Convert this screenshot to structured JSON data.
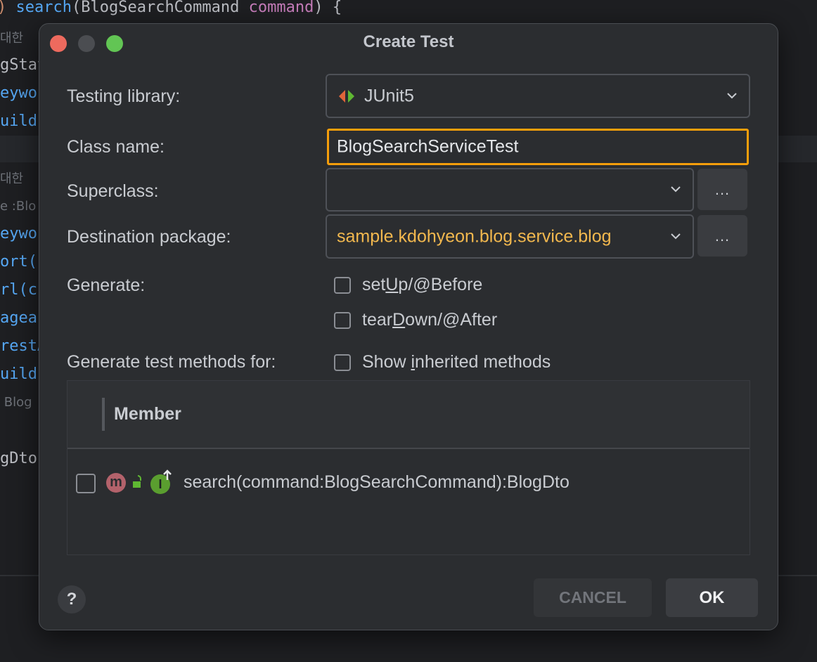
{
  "editor": {
    "line1": {
      "method": "search",
      "type": "BlogSearchCommand",
      "param": "command",
      "brace": ") {"
    },
    "fragments": [
      "대한 ",
      "gStat",
      "eywo",
      "uild",
      "대한 ",
      "e :Blo",
      "eywo",
      "ort(",
      "rl(c",
      "ageab",
      "restA",
      "uild",
      " Blog",
      "gDto"
    ]
  },
  "dialog": {
    "title": "Create Test",
    "testing_library_label": "Testing library:",
    "testing_library_value": "JUnit5",
    "class_name_label": "Class name:",
    "class_name_value": "BlogSearchServiceTest",
    "superclass_label": "Superclass:",
    "superclass_value": "",
    "destination_label": "Destination package:",
    "destination_value": "sample.kdohyeon.blog.service.blog",
    "browse_label": "...",
    "generate_label": "Generate:",
    "setup": {
      "pre": "set",
      "mnemonic": "U",
      "post": "p/@Before"
    },
    "teardown": {
      "pre": "tear",
      "mnemonic": "D",
      "post": "own/@After"
    },
    "methods_label": "Generate test methods for:",
    "show_inherited": {
      "pre": "Show ",
      "mnemonic": "i",
      "post": "nherited methods"
    },
    "member_header": "Member",
    "members": [
      {
        "signature": "search(command:BlogSearchCommand):BlogDto",
        "method_badge": "m",
        "interface_badge": "I"
      }
    ],
    "cancel_label": "CANCEL",
    "ok_label": "OK",
    "help_label": "?"
  },
  "colors": {
    "focus_border": "#f59e0b",
    "package_text": "#f2b84e",
    "accent_green": "#5fb832",
    "close": "#ed6a5e",
    "maximize": "#62c554"
  }
}
